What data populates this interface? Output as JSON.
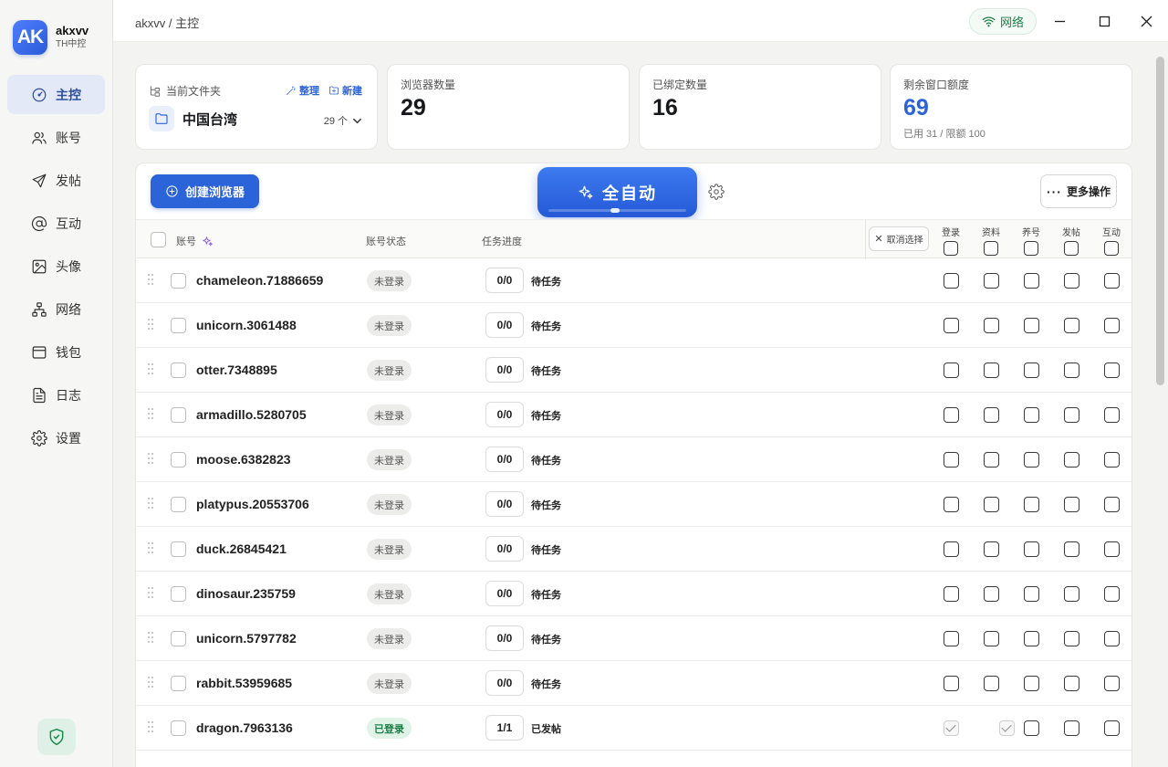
{
  "brand": {
    "logo": "AK",
    "name": "akxvv",
    "sub": "TH中控"
  },
  "nav": [
    {
      "label": "主控",
      "icon": "dashboard-icon",
      "active": true
    },
    {
      "label": "账号",
      "icon": "users-icon"
    },
    {
      "label": "发帖",
      "icon": "send-icon"
    },
    {
      "label": "互动",
      "icon": "at-icon"
    },
    {
      "label": "头像",
      "icon": "image-icon"
    },
    {
      "label": "网络",
      "icon": "network-icon"
    },
    {
      "label": "钱包",
      "icon": "wallet-icon"
    },
    {
      "label": "日志",
      "icon": "log-icon"
    },
    {
      "label": "设置",
      "icon": "gear-icon"
    }
  ],
  "topbar": {
    "breadcrumb": "akxvv / 主控",
    "network_label": "网络"
  },
  "folder": {
    "heading": "当前文件夹",
    "organize": "整理",
    "create": "新建",
    "name": "中国台湾",
    "count": "29 个"
  },
  "stats": {
    "browsers": {
      "label": "浏览器数量",
      "value": "29"
    },
    "bound": {
      "label": "已绑定数量",
      "value": "16"
    },
    "quota": {
      "label": "剩余窗口额度",
      "value": "69",
      "note": "已用 31 / 限额 100"
    }
  },
  "toolbar": {
    "create_label": "创建浏览器",
    "auto_label": "全自动",
    "more_label": "更多操作"
  },
  "table": {
    "headers": {
      "account": "账号",
      "status": "账号状态",
      "progress": "任务进度",
      "cancel": "取消选择"
    },
    "task_columns": [
      "登录",
      "资料",
      "养号",
      "发帖",
      "互动"
    ],
    "rows": [
      {
        "account": "chameleon.71886659",
        "status": "未登录",
        "progress": "0/0",
        "task": "待任务",
        "done": [
          false,
          false,
          false,
          false,
          false
        ]
      },
      {
        "account": "unicorn.3061488",
        "status": "未登录",
        "progress": "0/0",
        "task": "待任务",
        "done": [
          false,
          false,
          false,
          false,
          false
        ]
      },
      {
        "account": "otter.7348895",
        "status": "未登录",
        "progress": "0/0",
        "task": "待任务",
        "done": [
          false,
          false,
          false,
          false,
          false
        ]
      },
      {
        "account": "armadillo.5280705",
        "status": "未登录",
        "progress": "0/0",
        "task": "待任务",
        "done": [
          false,
          false,
          false,
          false,
          false
        ]
      },
      {
        "account": "moose.6382823",
        "status": "未登录",
        "progress": "0/0",
        "task": "待任务",
        "done": [
          false,
          false,
          false,
          false,
          false
        ]
      },
      {
        "account": "platypus.20553706",
        "status": "未登录",
        "progress": "0/0",
        "task": "待任务",
        "done": [
          false,
          false,
          false,
          false,
          false
        ]
      },
      {
        "account": "duck.26845421",
        "status": "未登录",
        "progress": "0/0",
        "task": "待任务",
        "done": [
          false,
          false,
          false,
          false,
          false
        ]
      },
      {
        "account": "dinosaur.235759",
        "status": "未登录",
        "progress": "0/0",
        "task": "待任务",
        "done": [
          false,
          false,
          false,
          false,
          false
        ]
      },
      {
        "account": "unicorn.5797782",
        "status": "未登录",
        "progress": "0/0",
        "task": "待任务",
        "done": [
          false,
          false,
          false,
          false,
          false
        ]
      },
      {
        "account": "rabbit.53959685",
        "status": "未登录",
        "progress": "0/0",
        "task": "待任务",
        "done": [
          false,
          false,
          false,
          false,
          false
        ]
      },
      {
        "account": "dragon.7963136",
        "status": "已登录",
        "progress": "1/1",
        "task": "已发帖",
        "done": [
          true,
          true,
          false,
          false,
          false
        ]
      }
    ]
  },
  "colors": {
    "accent": "#2b63d9",
    "success": "#1b7f47"
  }
}
